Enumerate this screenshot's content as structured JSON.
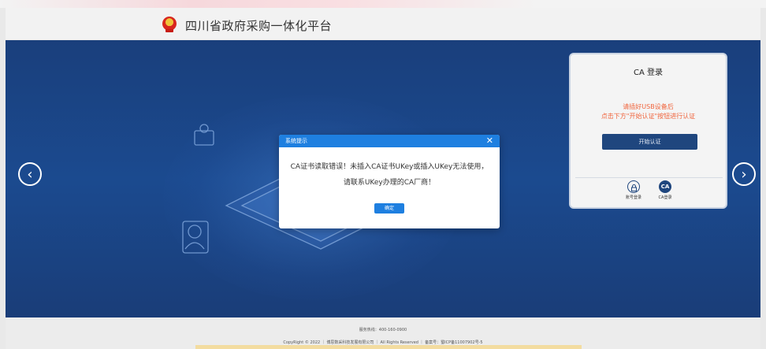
{
  "header": {
    "site_title": "四川省政府采购一体化平台"
  },
  "carousel": {
    "prev_label": "‹",
    "next_label": "›"
  },
  "ca_panel": {
    "title": "CA 登录",
    "hint_line1": "请插好USB设备后",
    "hint_line2": "点击下方\"开始认证\"按钮进行认证",
    "start_button": "开始认证",
    "option_account_label": "账号登录",
    "option_ca_label": "CA登录",
    "option_ca_icon_text": "CA"
  },
  "dialog": {
    "title": "系统提示",
    "close_glyph": "✕",
    "message_line1": "CA证书读取错误！未插入CA证书UKey或插入UKey无法使用，",
    "message_line2": "请联系UKey办理的CA厂商！",
    "ok_button": "确定"
  },
  "footer": {
    "hotline": "服务热线：400-160-0900",
    "copyright": "CopyRight © 2022 ｜ 博思数采科技发展有限公司 ｜ All Rights Reserved ｜ 备案号：蜀ICP备11007902号-5"
  },
  "colors": {
    "banner_blue": "#1b4a8f",
    "dialog_accent": "#1e7fe0",
    "hint_orange": "#f0643c",
    "panel_button": "#1f467e"
  }
}
